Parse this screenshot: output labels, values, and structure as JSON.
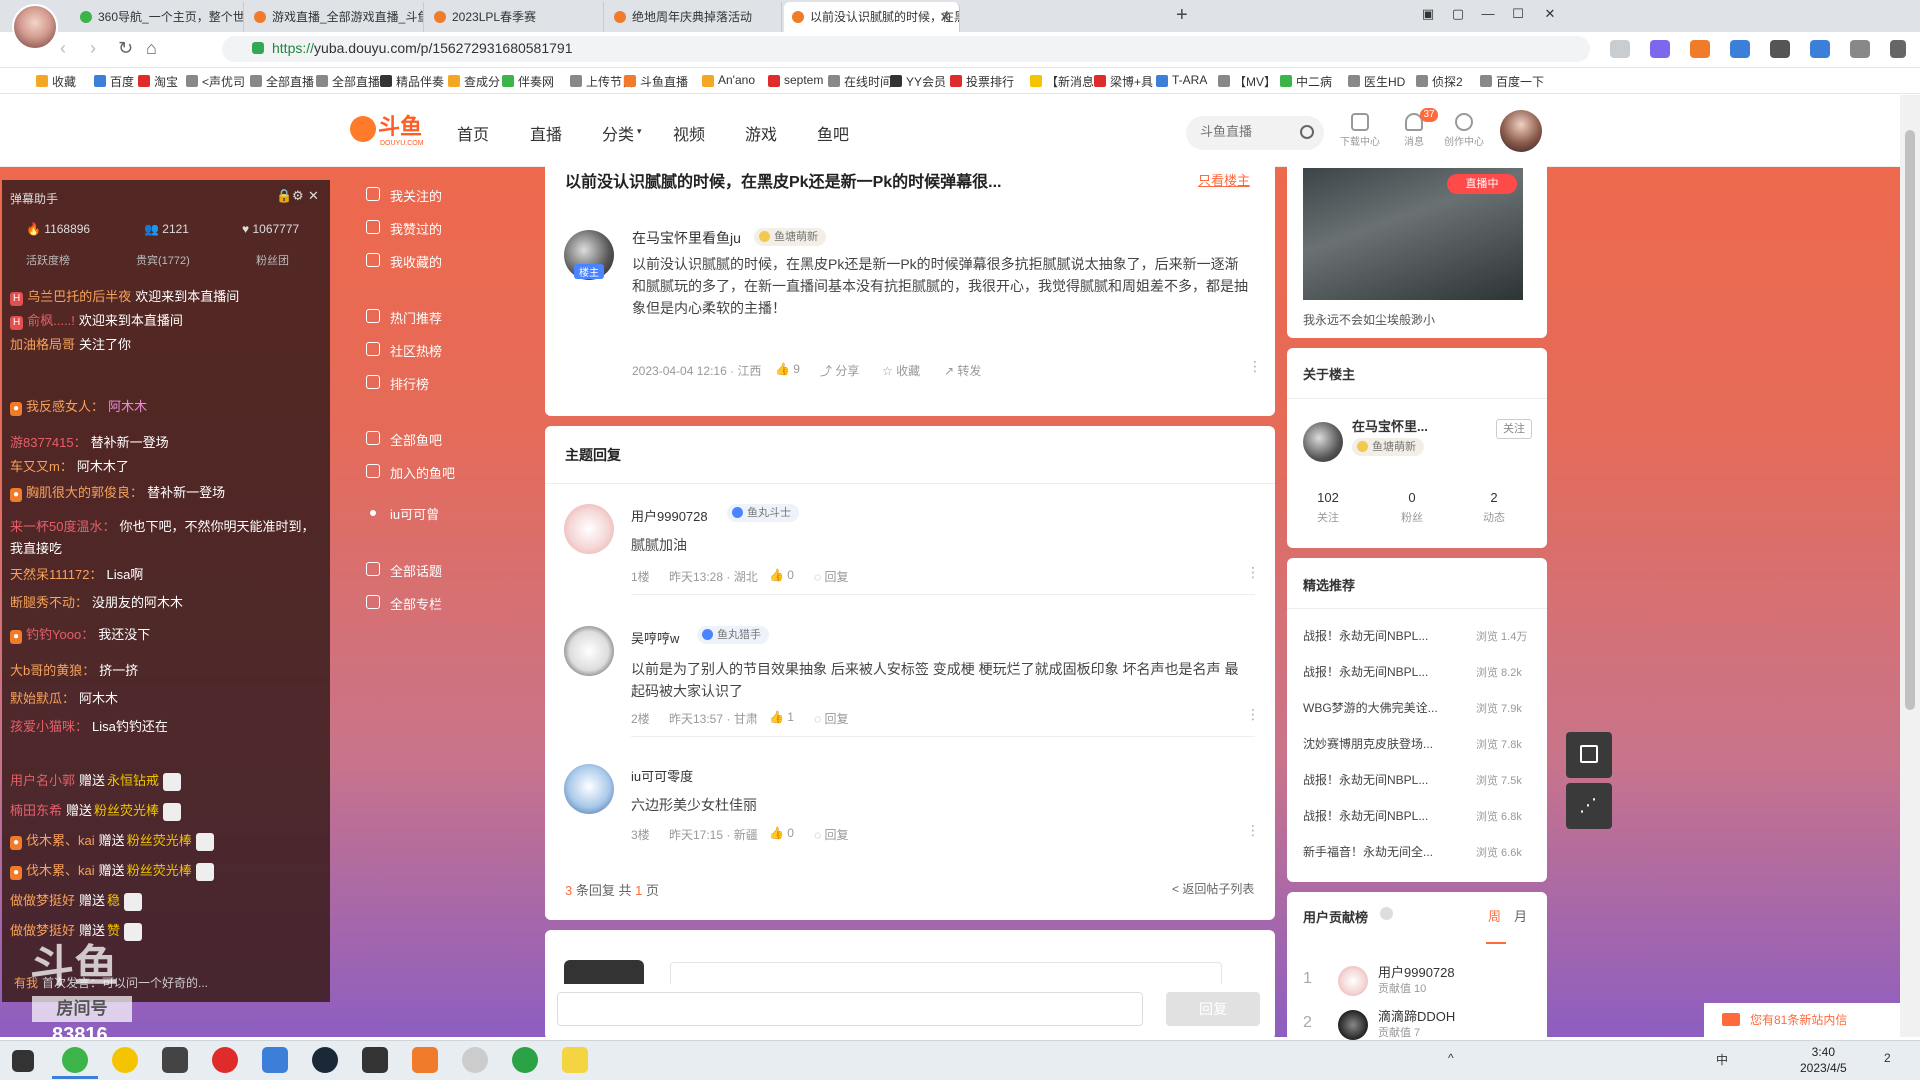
{
  "browser": {
    "tabs": [
      {
        "label": "360导航_一个主页，整个世界"
      },
      {
        "label": "游戏直播_全部游戏直播_斗鱼"
      },
      {
        "label": "2023LPL春季赛"
      },
      {
        "label": "绝地周年庆典掉落活动"
      },
      {
        "label": "以前没认识腻腻的时候，在黑"
      }
    ],
    "url_scheme": "https://",
    "url_rest": "yuba.douyu.com/p/156272931680581791",
    "bookmarks": [
      "收藏",
      "百度",
      "淘宝",
      "<声优司",
      "全部直播",
      "全部直播",
      "精品伴奏",
      "查成分",
      "伴奏网",
      "上传节目",
      "斗鱼直播",
      "An'ano",
      "septem",
      "在线时间",
      "YY会员",
      "投票排行",
      "【新消息",
      "梁博+具",
      "T-ARA",
      "【MV】",
      "中二病",
      "医生HD",
      "侦探2",
      "百度一下"
    ]
  },
  "site": {
    "logo_text": "斗鱼",
    "logo_sub": "DOUYU.COM",
    "nav": [
      "首页",
      "直播",
      "分类",
      "视频",
      "游戏",
      "鱼吧"
    ],
    "search_placeholder": "斗鱼直播",
    "header_icons": [
      {
        "label": "下载中心",
        "icon": "download-icon"
      },
      {
        "label": "消息",
        "icon": "bell-icon"
      },
      {
        "label": "创作中心",
        "icon": "bulb-icon"
      }
    ],
    "message_count": "37"
  },
  "danmu": {
    "title": "弹幕助手",
    "stats": [
      "1168896",
      "2121",
      "1067777"
    ],
    "tabs": [
      "活跃度榜",
      "贵宾(1772)",
      "粉丝团"
    ],
    "lines": [
      {
        "user": "乌兰巴托的后半夜",
        "text": "欢迎来到本直播间"
      },
      {
        "user": "俞枫.....!",
        "text": "欢迎来到本直播间"
      },
      {
        "user": "加油格局哥",
        "text": "关注了你"
      },
      {
        "user": "我反感女人：",
        "text": "阿木木"
      },
      {
        "user": "游8377415：",
        "text": "替补新一登场"
      },
      {
        "user": "车又又m：",
        "text": "阿木木了"
      },
      {
        "user": "胸肌很大的郭俊良：",
        "text": "替补新一登场"
      },
      {
        "user": "来一杯50度温水：",
        "text": "你也下吧，不然你明天能准时到，我直接吃"
      },
      {
        "user": "天然呆111172：",
        "text": "Lisa啊"
      },
      {
        "user": "断腿秀不动：",
        "text": "没朋友的阿木木"
      },
      {
        "user": "钓钓Yooo：",
        "text": "我还没下"
      },
      {
        "user": "大b哥的黄狼：",
        "text": "挤一挤"
      },
      {
        "user": "默始默瓜：",
        "text": "阿木木"
      },
      {
        "user": "孩爱小猫咪：",
        "text": "Lisa钓钓还在"
      }
    ],
    "gifts": [
      {
        "user": "用户名小郭",
        "verb": "赠送",
        "item": "永恒钻戒"
      },
      {
        "user": "楠田东希",
        "verb": "赠送",
        "item": "粉丝荧光棒"
      },
      {
        "user": "伐木累、kai",
        "verb": "赠送",
        "item": "粉丝荧光棒"
      },
      {
        "user": "伐木累、kai",
        "verb": "赠送",
        "item": "粉丝荧光棒"
      },
      {
        "user": "做做梦挺好",
        "verb": "赠送",
        "item": "稳"
      },
      {
        "user": "做做梦挺好",
        "verb": "赠送",
        "item": "赞"
      }
    ],
    "last_line": {
      "user": "有我",
      "text": "首次发言：可以问一个好奇的..."
    },
    "room_logo": "斗鱼",
    "room_label": "房间号",
    "room_num": "83816"
  },
  "left_menu": {
    "items": [
      "我关注的",
      "我赞过的",
      "我收藏的",
      "热门推荐",
      "社区热榜",
      "排行榜",
      "全部鱼吧",
      "加入的鱼吧",
      "iu可可曾",
      "全部话题",
      "全部专栏"
    ]
  },
  "post": {
    "title": "以前没认识腻腻的时候，在黑皮Pk还是新一Pk的时候弹幕很...",
    "only_op": "只看楼主",
    "author": "在马宝怀里看鱼ju",
    "author_badge": "鱼塘萌新",
    "op_tag": "楼主",
    "body": "以前没认识腻腻的时候，在黑皮Pk还是新一Pk的时候弹幕很多抗拒腻腻说太抽象了，后来新一逐渐和腻腻玩的多了，在新一直播间基本没有抗拒腻腻的，我很开心，我觉得腻腻和周姐差不多，都是抽象但是内心柔软的主播！",
    "meta": "2023-04-04 12:16 · 江西",
    "likes": "9",
    "share": "分享",
    "collect": "收藏",
    "forward": "转发"
  },
  "replies": {
    "header": "主题回复",
    "items": [
      {
        "user": "用户9990728",
        "badge": "鱼丸斗士",
        "text": "腻腻加油",
        "floor": "1楼",
        "time": "昨天13:28 · 湖北",
        "likes": "0",
        "reply": "回复"
      },
      {
        "user": "吴哼哼w",
        "badge": "鱼丸猎手",
        "text": "以前是为了别人的节目效果抽象 后来被人安标签 变成梗 梗玩烂了就成固板印象 坏名声也是名声 最起码被大家认识了",
        "floor": "2楼",
        "time": "昨天13:57 · 甘肃",
        "likes": "1",
        "reply": "回复"
      },
      {
        "user": "iu可可零度",
        "badge": "",
        "text": "六边形美少女杜佳丽",
        "floor": "3楼",
        "time": "昨天17:15 · 新疆",
        "likes": "0",
        "reply": "回复"
      }
    ],
    "pager_count": "3",
    "pager_mid": "条回复 共",
    "pager_pages": "1",
    "pager_end": "页",
    "back": "< 返回帖子列表",
    "submit": "回复"
  },
  "sidebar": {
    "live_badge": "直播中",
    "stream_caption": "我永远不会如尘埃般渺小",
    "about_title": "关于楼主",
    "about_name": "在马宝怀里...",
    "about_badge": "鱼塘萌新",
    "follow": "关注",
    "stats": [
      {
        "n": "102",
        "l": "关注"
      },
      {
        "n": "0",
        "l": "粉丝"
      },
      {
        "n": "2",
        "l": "动态"
      }
    ],
    "rec_title": "精选推荐",
    "recs": [
      {
        "t": "战报！永劫无间NBPL...",
        "v": "浏览 1.4万"
      },
      {
        "t": "战报！永劫无间NBPL...",
        "v": "浏览 8.2k"
      },
      {
        "t": "WBG梦游的大佛完美诠...",
        "v": "浏览 7.9k"
      },
      {
        "t": "沈妙赛博朋克皮肤登场...",
        "v": "浏览 7.8k"
      },
      {
        "t": "战报！永劫无间NBPL...",
        "v": "浏览 7.5k"
      },
      {
        "t": "战报！永劫无间NBPL...",
        "v": "浏览 6.8k"
      },
      {
        "t": "新手福音！永劫无间全...",
        "v": "浏览 6.6k"
      }
    ],
    "rank_title": "用户贡献榜",
    "rank_tabs": [
      "周",
      "月"
    ],
    "ranks": [
      {
        "n": "1",
        "name": "用户9990728",
        "sub": "贡献值 10"
      },
      {
        "n": "2",
        "name": "滴滴蹄DDOH",
        "sub": "贡献值 7"
      }
    ]
  },
  "notify": "您有81条新站内信",
  "taskbar": {
    "time": "3:40",
    "date": "2023/4/5",
    "ime": "中",
    "notif_count": "2"
  }
}
